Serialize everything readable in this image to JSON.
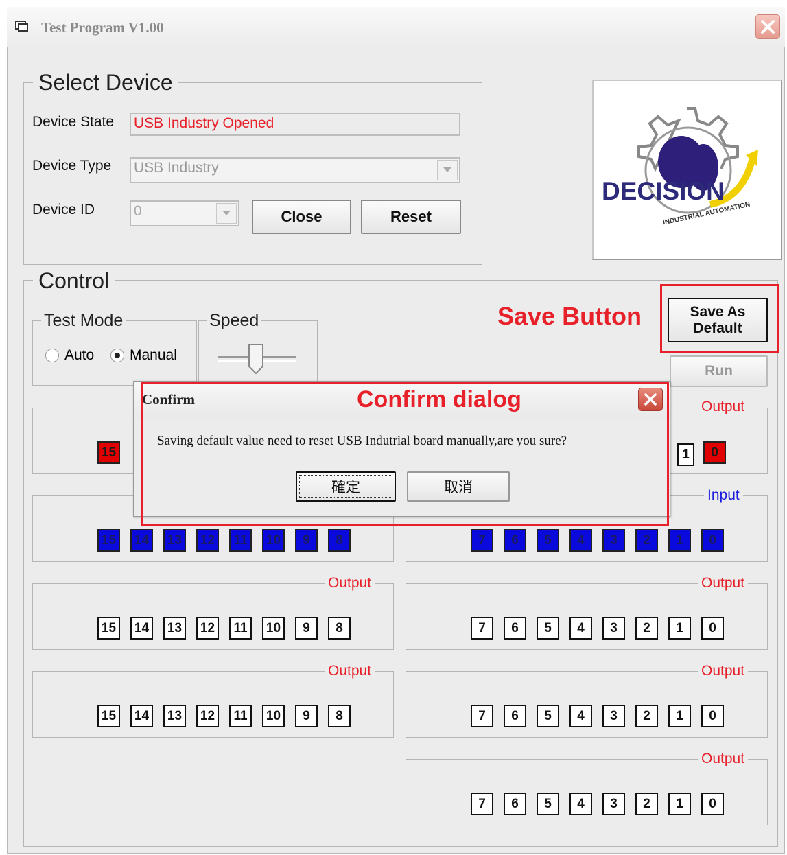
{
  "window": {
    "title": "Test Program V1.00"
  },
  "select_device": {
    "legend": "Select Device",
    "state_label": "Device State",
    "state_value": "USB Industry Opened",
    "type_label": "Device Type",
    "type_value": "USB Industry",
    "id_label": "Device ID",
    "id_value": "0",
    "close_label": "Close",
    "reset_label": "Reset"
  },
  "logo": {
    "text": "DECISION",
    "subtitle": "INDUSTRIAL AUTOMATION"
  },
  "control": {
    "legend": "Control",
    "test_mode_legend": "Test Mode",
    "auto_label": "Auto",
    "manual_label": "Manual",
    "selected_mode": "Manual",
    "speed_legend": "Speed",
    "save_default_line1": "Save As",
    "save_default_line2": "Default",
    "run_label": "Run"
  },
  "annotations": {
    "save_button": "Save Button",
    "confirm_dialog": "Confirm dialog"
  },
  "dialog": {
    "title": "Confirm",
    "message": "Saving default value need to reset USB Indutrial board manually,are you sure?",
    "ok_label": "確定",
    "cancel_label": "取消"
  },
  "panels": {
    "output": "Output",
    "input": "Input",
    "high_bits": [
      "15",
      "14",
      "13",
      "12",
      "11",
      "10",
      "9",
      "8"
    ],
    "low_bits": [
      "7",
      "6",
      "5",
      "4",
      "3",
      "2",
      "1",
      "0"
    ],
    "partial_left_bit": "15",
    "partial_right_bits": [
      "1",
      "0"
    ]
  },
  "colors": {
    "active_output": "#e00000",
    "input_on": "#0a0adc",
    "input_label": "#1a1adc",
    "output_label": "#e8202a",
    "annotation": "#e8202a"
  }
}
